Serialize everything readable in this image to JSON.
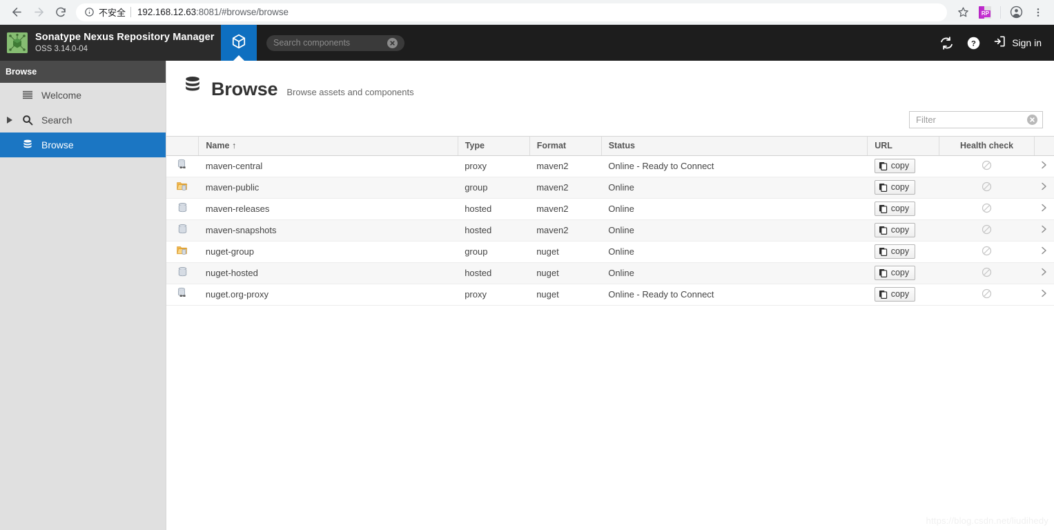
{
  "browser": {
    "back_icon": "back-arrow-icon",
    "forward_icon": "forward-arrow-icon",
    "reload_icon": "reload-icon",
    "info_icon": "info-circle-icon",
    "security_label": "不安全",
    "url_host": "192.168.12.63",
    "url_port_path": ":8081/#browse/browse",
    "bookmark_icon": "star-icon",
    "extension_label": "RP",
    "profile_icon": "avatar-icon",
    "menu_icon": "three-dot-menu-icon"
  },
  "header": {
    "product_title": "Sonatype Nexus Repository Manager",
    "version": "OSS 3.14.0-04",
    "logo_icon": "nexus-cube-logo",
    "tab_icon": "cube-icon",
    "search_placeholder": "Search components",
    "search_value": "",
    "search_clear_icon": "clear-circle-icon",
    "refresh_icon": "refresh-icon",
    "help_icon": "help-circle-icon",
    "signin_icon": "sign-in-icon",
    "signin_label": "Sign in",
    "accent_color": "#0e6fc0",
    "bar_color": "#1d1d1d"
  },
  "sidebar": {
    "section_title": "Browse",
    "items": [
      {
        "label": "Welcome",
        "icon": "lines-list-icon",
        "active": false,
        "expandable": false
      },
      {
        "label": "Search",
        "icon": "magnifier-icon",
        "active": false,
        "expandable": true
      },
      {
        "label": "Browse",
        "icon": "database-icon",
        "active": true,
        "expandable": false
      }
    ],
    "active_color": "#1b76c3"
  },
  "main": {
    "title": "Browse",
    "title_icon": "database-icon",
    "subtitle": "Browse assets and components",
    "filter": {
      "placeholder": "Filter",
      "value": "",
      "clear_icon": "clear-circle-icon"
    },
    "table": {
      "columns": [
        {
          "key": "icon",
          "label": ""
        },
        {
          "key": "name",
          "label": "Name",
          "sort": "↑"
        },
        {
          "key": "type",
          "label": "Type"
        },
        {
          "key": "format",
          "label": "Format"
        },
        {
          "key": "status",
          "label": "Status"
        },
        {
          "key": "url",
          "label": "URL"
        },
        {
          "key": "health",
          "label": "Health check"
        },
        {
          "key": "chevron",
          "label": ""
        }
      ],
      "copy_label": "copy",
      "copy_icon": "copy-icon",
      "health_icon": "prohibited-circle-icon",
      "chevron_icon": "chevron-right-icon",
      "rows": [
        {
          "icon": "repo-proxy-icon",
          "name": "maven-central",
          "type": "proxy",
          "format": "maven2",
          "status": "Online - Ready to Connect"
        },
        {
          "icon": "repo-group-icon",
          "name": "maven-public",
          "type": "group",
          "format": "maven2",
          "status": "Online"
        },
        {
          "icon": "repo-hosted-icon",
          "name": "maven-releases",
          "type": "hosted",
          "format": "maven2",
          "status": "Online"
        },
        {
          "icon": "repo-hosted-icon",
          "name": "maven-snapshots",
          "type": "hosted",
          "format": "maven2",
          "status": "Online"
        },
        {
          "icon": "repo-group-icon",
          "name": "nuget-group",
          "type": "group",
          "format": "nuget",
          "status": "Online"
        },
        {
          "icon": "repo-hosted-icon",
          "name": "nuget-hosted",
          "type": "hosted",
          "format": "nuget",
          "status": "Online"
        },
        {
          "icon": "repo-proxy-icon",
          "name": "nuget.org-proxy",
          "type": "proxy",
          "format": "nuget",
          "status": "Online - Ready to Connect"
        }
      ]
    },
    "watermark": "https://blog.csdn.net/liudihedy"
  }
}
